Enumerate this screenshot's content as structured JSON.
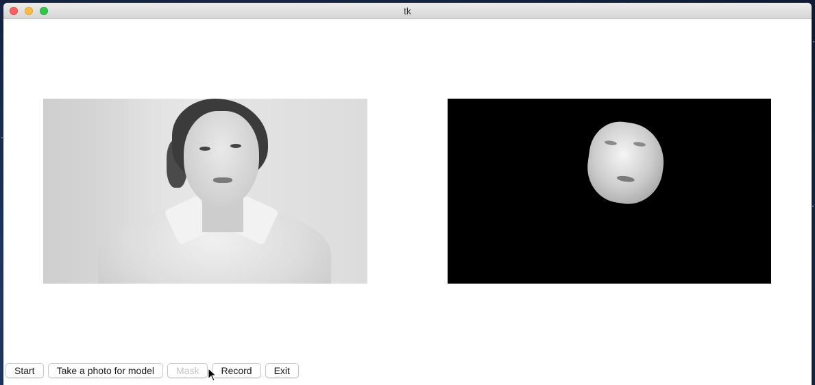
{
  "window": {
    "title": "tk"
  },
  "panes": {
    "left": {
      "content": "grayscale webcam frame"
    },
    "right": {
      "content": "3D face mask render"
    }
  },
  "toolbar": {
    "buttons": [
      {
        "label": "Start",
        "enabled": true
      },
      {
        "label": "Take a photo for model",
        "enabled": true
      },
      {
        "label": "Mask",
        "enabled": false
      },
      {
        "label": "Record",
        "enabled": true
      },
      {
        "label": "Exit",
        "enabled": true
      }
    ]
  },
  "icons": {
    "close": "close-icon",
    "minimize": "minimize-icon",
    "maximize": "maximize-icon",
    "cursor": "pointer-cursor-icon"
  },
  "colors": {
    "close": "#fc605c",
    "minimize": "#fdbc40",
    "maximize": "#34c84a"
  }
}
